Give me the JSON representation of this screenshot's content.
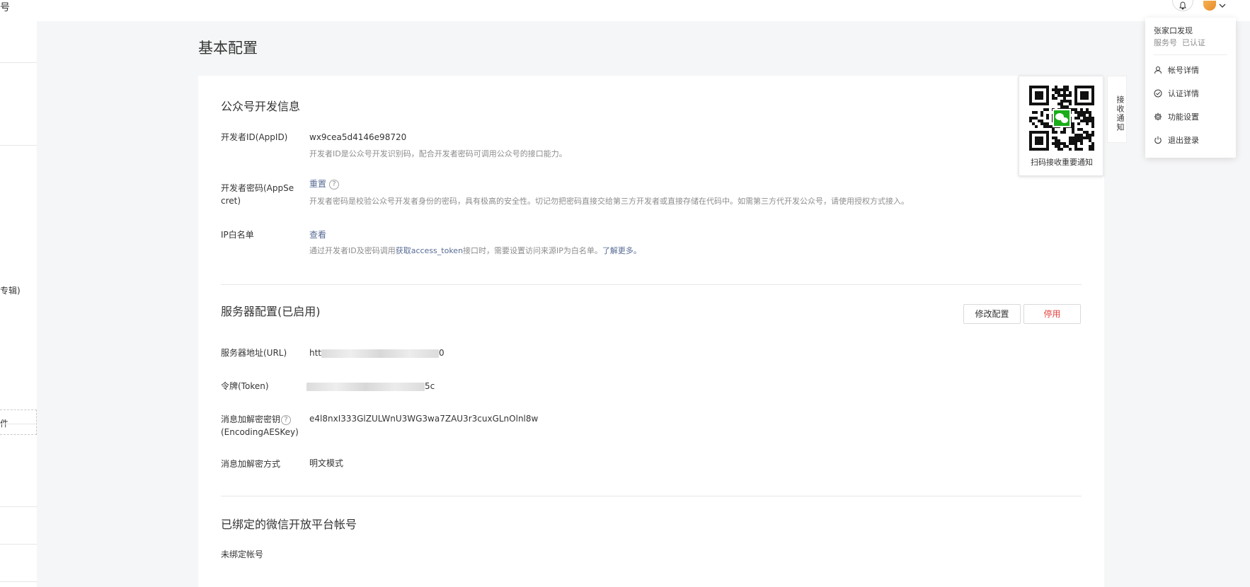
{
  "topbar": {
    "edge_glyph": "号"
  },
  "sidebar": {
    "fragment_1": "专辑)",
    "fragment_2": "件"
  },
  "page": {
    "title": "基本配置"
  },
  "dev_info": {
    "section_title": "公众号开发信息",
    "appid_label": "开发者ID(AppID)",
    "appid_value": "wx9cea5d4146e98720",
    "appid_desc": "开发者ID是公众号开发识别码，配合开发者密码可调用公众号的接口能力。",
    "secret_label": "开发者密码(AppSecret)",
    "secret_action": "重置",
    "secret_help": "?",
    "secret_desc": "开发者密码是校验公众号开发者身份的密码，具有极高的安全性。切记勿把密码直接交给第三方开发者或直接存储在代码中。如需第三方代开发公众号，请使用授权方式接入。",
    "ip_label": "IP白名单",
    "ip_action": "查看",
    "ip_desc_1": "通过开发者ID及密码调用",
    "ip_desc_link": "获取access_token",
    "ip_desc_2": "接口时，需要设置访问来源IP为白名单。",
    "ip_desc_more": "了解更多。"
  },
  "server_config": {
    "section_title": "服务器配置(已启用)",
    "modify_button": "修改配置",
    "disable_button": "停用",
    "url_label": "服务器地址(URL)",
    "url_prefix": "htt",
    "url_suffix": "0",
    "token_label": "令牌(Token)",
    "token_suffix": "5c",
    "aeskey_label": "消息加解密密钥",
    "aeskey_label_2": "(EncodingAESKey)",
    "aeskey_help": "?",
    "aeskey_value": "e4l8nxI333GlZULWnU3WG3wa7ZAU3r3cuxGLnOlnl8w",
    "mode_label": "消息加解密方式",
    "mode_value": "明文模式"
  },
  "open_platform": {
    "section_title": "已绑定的微信开放平台帐号",
    "status": "未绑定帐号"
  },
  "qr_panel": {
    "caption": "扫码接收重要通知"
  },
  "notify_tab": {
    "label": "接收通知"
  },
  "account_menu": {
    "name": "张家口发现",
    "type": "服务号",
    "verified": "已认证",
    "items": [
      {
        "label": "帐号详情",
        "icon": "user-icon"
      },
      {
        "label": "认证详情",
        "icon": "check-circle-icon"
      },
      {
        "label": "功能设置",
        "icon": "gear-icon"
      },
      {
        "label": "退出登录",
        "icon": "power-icon"
      }
    ]
  },
  "colors": {
    "link": "#576b95",
    "danger": "#e64340",
    "wechat_green": "#1aad19"
  }
}
